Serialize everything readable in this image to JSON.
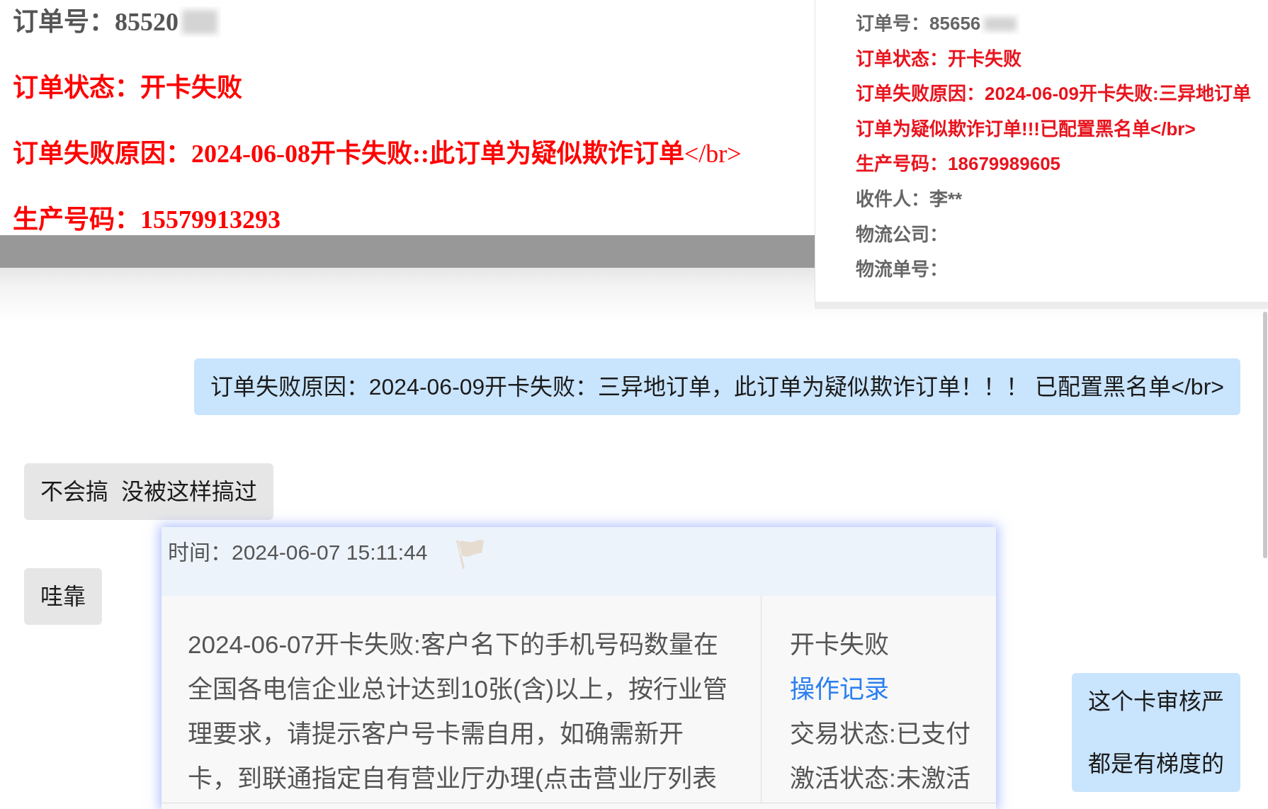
{
  "order_page": {
    "lines": [
      {
        "text": "订单号：85520",
        "color": "#555555",
        "bold": true,
        "redacted": true
      },
      {
        "text": "订单状态：开卡失败",
        "color": "#ff0000",
        "bold": true,
        "redacted": false
      },
      {
        "text": "**订单失败原因：2024-06-08开卡失败::此订单为疑似欺诈订单**</br>",
        "color": "#ff0000",
        "bold": false,
        "redacted": false
      },
      {
        "text": "生产号码：15579913293",
        "color": "#ff0000",
        "bold": true,
        "redacted": false
      }
    ]
  },
  "order_panel": {
    "lines": [
      {
        "text": "订单号：85656",
        "color": "#666666",
        "redacted": true
      },
      {
        "text": "订单状态：开卡失败",
        "color": "#e8141e",
        "redacted": false
      },
      {
        "text": "订单失败原因：2024-06-09开卡失败:三异地订单",
        "color": "#e8141e",
        "redacted": false
      },
      {
        "text": "订单为疑似欺诈订单!!!已配置黑名单</br>",
        "color": "#e8141e",
        "redacted": false
      },
      {
        "text": "生产号码：18679989605",
        "color": "#e8141e",
        "redacted": false
      },
      {
        "text": "收件人：李**",
        "color": "#666666",
        "redacted": false
      },
      {
        "text": "物流公司：",
        "color": "#666666",
        "redacted": false
      },
      {
        "text": "物流单号：",
        "color": "#666666",
        "redacted": false
      }
    ]
  },
  "chat": {
    "messages": [
      {
        "kind": "sent",
        "lines": [
          "订单失败原因：2024-06-09开卡失败：三异地订单，此订单为疑似欺诈订单！！！ 已配置黑名单</br>"
        ]
      },
      {
        "kind": "received",
        "lines": [
          "不会搞  没被这样搞过"
        ]
      },
      {
        "kind": "received",
        "lines": [
          "哇靠"
        ]
      },
      {
        "kind": "sent",
        "lines": [
          "这个卡审核严",
          "都是有梯度的"
        ]
      }
    ]
  },
  "record_card": {
    "header": "时间：2024-06-07 15:11:44",
    "detail": "2024-06-07开卡失败:客户名下的手机号码数量在全国各电信企业总计达到10张(含)以上，按行业管理要求，请提示客户号卡需自用，如确需新开卡，到联通指定自有营业厅办理(点击营业厅列表",
    "side_items": [
      {
        "kind": "text",
        "text": "开卡失败"
      },
      {
        "kind": "link",
        "text": "操作记录"
      },
      {
        "kind": "text",
        "text": "交易状态:已支付"
      },
      {
        "kind": "text",
        "text": "激活状态:未激活"
      }
    ]
  }
}
